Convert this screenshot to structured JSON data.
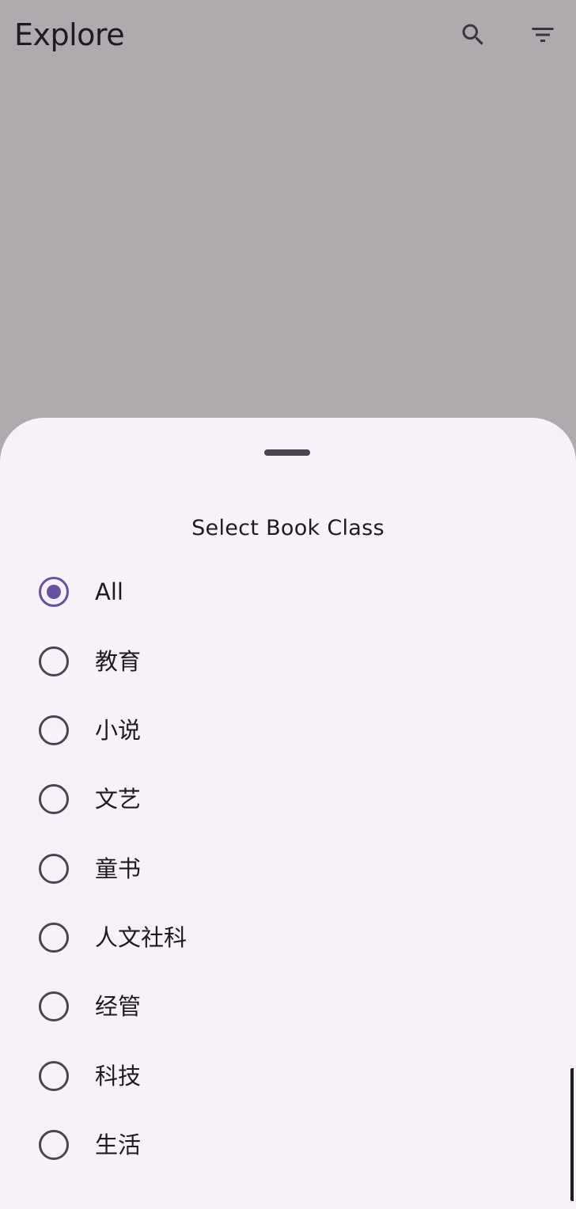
{
  "app_bar": {
    "title": "Explore",
    "search_icon": "search-icon",
    "filter_icon": "filter-icon"
  },
  "sheet": {
    "title": "Select Book Class",
    "selected": "All",
    "options": [
      {
        "label": "All",
        "checked": true
      },
      {
        "label": "教育",
        "checked": false
      },
      {
        "label": "小说",
        "checked": false
      },
      {
        "label": "文艺",
        "checked": false
      },
      {
        "label": "童书",
        "checked": false
      },
      {
        "label": "人文社科",
        "checked": false
      },
      {
        "label": "经管",
        "checked": false
      },
      {
        "label": "科技",
        "checked": false
      },
      {
        "label": "生活",
        "checked": false
      }
    ]
  },
  "colors": {
    "scrim": "#aeaaad",
    "sheet_background": "#f7f2fa",
    "primary": "#6750a4",
    "on_surface_variant": "#49454f",
    "on_surface": "#1d1b20"
  }
}
